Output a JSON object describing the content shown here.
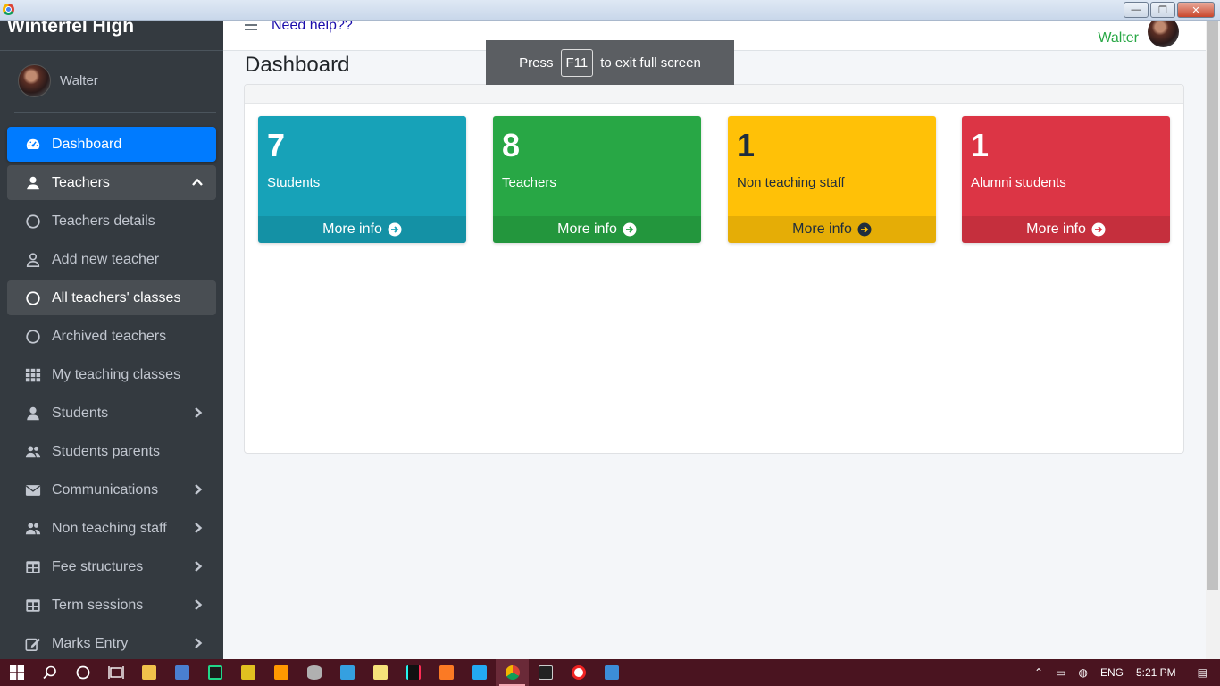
{
  "sidebar": {
    "brand": "Winterfel High",
    "user_name": "Walter",
    "items": [
      {
        "label": "Dashboard",
        "icon": "tachometer-icon"
      },
      {
        "label": "Teachers",
        "icon": "user-icon"
      },
      {
        "label": "Teachers details",
        "icon": "circle-icon"
      },
      {
        "label": "Add new teacher",
        "icon": "user-outline-icon"
      },
      {
        "label": "All teachers' classes",
        "icon": "circle-icon"
      },
      {
        "label": "Archived teachers",
        "icon": "circle-icon"
      },
      {
        "label": "My teaching classes",
        "icon": "grid-icon"
      },
      {
        "label": "Students",
        "icon": "user-icon"
      },
      {
        "label": "Students parents",
        "icon": "users-icon"
      },
      {
        "label": "Communications",
        "icon": "envelope-icon"
      },
      {
        "label": "Non teaching staff",
        "icon": "users-icon"
      },
      {
        "label": "Fee structures",
        "icon": "table-icon"
      },
      {
        "label": "Term sessions",
        "icon": "table-icon"
      },
      {
        "label": "Marks Entry",
        "icon": "edit-icon"
      }
    ]
  },
  "topnav": {
    "help_link": "Need help??",
    "user_name": "Walter"
  },
  "page": {
    "title": "Dashboard"
  },
  "stats": [
    {
      "value": "7",
      "label": "Students",
      "more": "More info",
      "color": "#17a2b8"
    },
    {
      "value": "8",
      "label": "Teachers",
      "more": "More info",
      "color": "#28a745"
    },
    {
      "value": "1",
      "label": "Non teaching staff",
      "more": "More info",
      "color": "#ffc107"
    },
    {
      "value": "1",
      "label": "Alumni students",
      "more": "More info",
      "color": "#dc3545"
    }
  ],
  "fullscreen_notice": {
    "pre": "Press",
    "key": "F11",
    "post": "to exit full screen"
  },
  "taskbar": {
    "language": "ENG",
    "time": "5:21 PM"
  },
  "window_controls": {
    "minimize": "—",
    "restore": "❐",
    "close": "✕"
  }
}
